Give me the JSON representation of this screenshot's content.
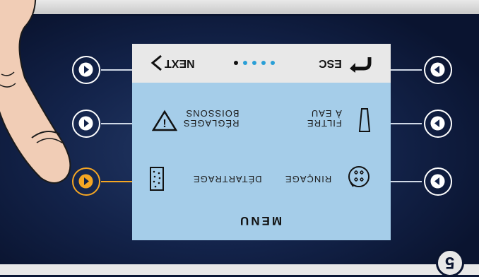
{
  "screen": {
    "header": {
      "next_label": "NEXT",
      "esc_label": "ESC",
      "page_dots": 5,
      "selected_dot": 5
    },
    "items": [
      {
        "label_line1": "RÉGLAGES",
        "label_line2": "BOISSONS",
        "icon": "settings-warning-icon"
      },
      {
        "label_line1": "FILTRE",
        "label_line2": "À EAU",
        "icon": "water-filter-icon"
      },
      {
        "label_line1": "DÉTARTRAGE",
        "label_line2": "",
        "icon": "descaling-icon"
      },
      {
        "label_line1": "RINÇAGE",
        "label_line2": "",
        "icon": "rinse-icon"
      }
    ],
    "menu_title": "MENU"
  },
  "page_number": "5",
  "colors": {
    "accent": "#f5a623",
    "screen_bg": "#a5cde9",
    "bezel": "#13234a"
  }
}
